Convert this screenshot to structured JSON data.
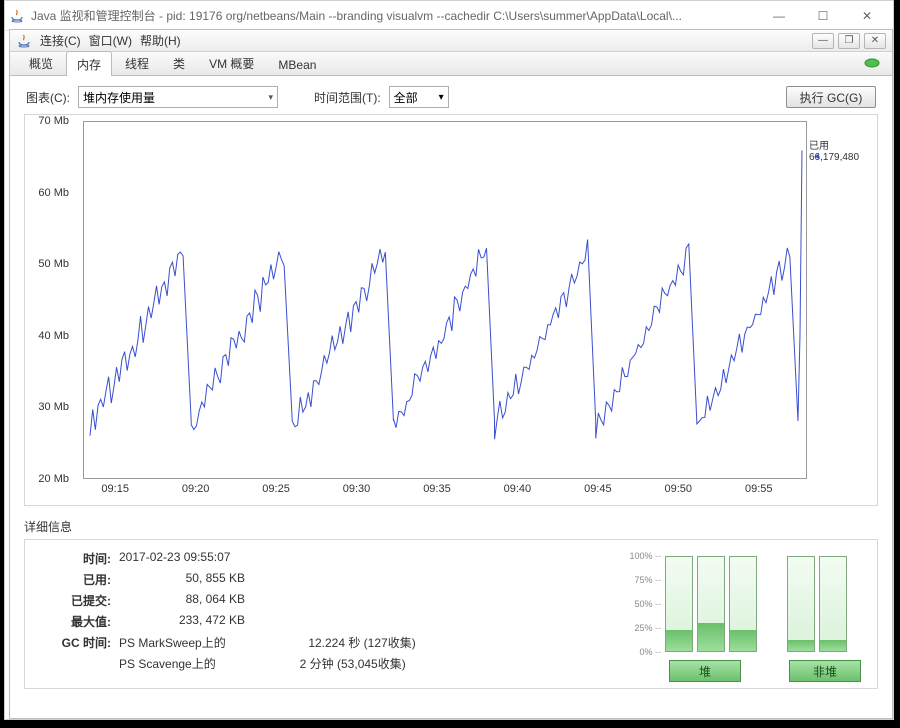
{
  "outerWindow": {
    "title": "Java 监视和管理控制台 - pid: 19176 org/netbeans/Main --branding visualvm --cachedir C:\\Users\\summer\\AppData\\Local\\..."
  },
  "innerWindow": {
    "menu": {
      "connect": "连接(C)",
      "window": "窗口(W)",
      "help": "帮助(H)"
    }
  },
  "tabs": {
    "overview": "概览",
    "memory": "内存",
    "threads": "线程",
    "classes": "类",
    "vm": "VM 概要",
    "mbean": "MBean"
  },
  "toolbar": {
    "chartLabel": "图表(C):",
    "chartValue": "堆内存使用量",
    "timeLabel": "时间范围(T):",
    "timeValue": "全部",
    "gcButton": "执行 GC(G)"
  },
  "chart_data": {
    "type": "line",
    "title": "",
    "xlabel": "",
    "ylabel": "Mb",
    "ylim": [
      20,
      70
    ],
    "yticks": [
      20,
      30,
      40,
      50,
      60,
      70
    ],
    "ytick_labels": [
      "20 Mb",
      "30 Mb",
      "40 Mb",
      "50 Mb",
      "60 Mb",
      "70 Mb"
    ],
    "x_categories": [
      "09:15",
      "09:20",
      "09:25",
      "09:30",
      "09:35",
      "09:40",
      "09:45",
      "09:50",
      "09:55"
    ],
    "annotation": {
      "label": "已用",
      "value": "66,179,480"
    },
    "series": [
      {
        "name": "已用",
        "color": "#3a4fd0",
        "pattern": "sawtooth",
        "cycles": 7,
        "min": 27,
        "max": 52,
        "final_spike": 66
      }
    ]
  },
  "details": {
    "title": "详细信息",
    "rows": {
      "timeK": "时间:",
      "timeV": "2017-02-23 09:55:07",
      "usedK": "已用:",
      "usedV": "50, 855 KB",
      "committedK": "已提交:",
      "committedV": "88, 064 KB",
      "maxK": "最大值:",
      "maxV": "233, 472 KB",
      "gcK": "GC 时间:",
      "gcName1": "PS MarkSweep上的",
      "gcVal1": "12.224 秒 (127收集)",
      "gcName2": "PS Scavenge上的",
      "gcVal2": "2 分钟 (53,045收集)"
    },
    "scale": {
      "p0": "0%",
      "p25": "25%",
      "p50": "50%",
      "p75": "75%",
      "p100": "100%"
    },
    "barsG1": [
      22,
      30,
      22
    ],
    "barsG2": [
      12,
      12
    ],
    "btnHeap": "堆",
    "btnNonHeap": "非堆"
  }
}
